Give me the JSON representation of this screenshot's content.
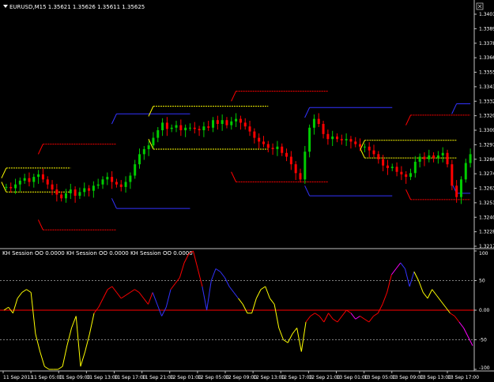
{
  "window": {
    "title": "EURUSD,M15  1.35621 1.35626 1.35611 1.35625",
    "menu_icon": "triangle-down-icon",
    "close_icon": "close-box-icon"
  },
  "indicator": {
    "label": "KH Session OO 0.0000  KH Session OO 0.0000  KH Session OO 0.0000"
  },
  "colors": {
    "background": "#000000",
    "bull_candle": "#00cc00",
    "bear_candle": "#ff0000",
    "band_yellow": "#ffff00",
    "band_red": "#ff0000",
    "band_blue": "#3333ff",
    "osc_yellow": "#ffff00",
    "osc_red": "#ff0000",
    "osc_blue": "#3333ff",
    "osc_magenta": "#ff00ff",
    "zero_line": "#ff0000",
    "level_line": "#808080",
    "axis": "#c0c0c0"
  },
  "chart_data": [
    {
      "type": "candlestick",
      "symbol": "EURUSD",
      "timeframe": "M15",
      "y_ticks": [
        "1.34010",
        "1.33895",
        "1.33780",
        "1.33665",
        "1.33550",
        "1.33435",
        "1.33320",
        "1.33205",
        "1.33090",
        "1.32975",
        "1.32860",
        "1.32745",
        "1.32630",
        "1.32515",
        "1.32400",
        "1.32285",
        "1.32170"
      ],
      "ylim": [
        1.3217,
        1.3401
      ],
      "closes": [
        1.3264,
        1.3263,
        1.3266,
        1.3269,
        1.3271,
        1.3268,
        1.3272,
        1.3274,
        1.327,
        1.3266,
        1.3262,
        1.3258,
        1.3255,
        1.3259,
        1.3262,
        1.3257,
        1.326,
        1.3263,
        1.3261,
        1.3265,
        1.3266,
        1.327,
        1.3272,
        1.3268,
        1.3266,
        1.3264,
        1.3268,
        1.3273,
        1.3282,
        1.329,
        1.3294,
        1.3297,
        1.3303,
        1.3309,
        1.3315,
        1.331,
        1.3311,
        1.3313,
        1.3309,
        1.3311,
        1.3311,
        1.331,
        1.3309,
        1.3312,
        1.3311,
        1.3317,
        1.3314,
        1.3317,
        1.3313,
        1.3316,
        1.3318,
        1.3315,
        1.3312,
        1.3308,
        1.3303,
        1.33,
        1.3298,
        1.3295,
        1.3294,
        1.3296,
        1.3291,
        1.3288,
        1.3282,
        1.3275,
        1.327,
        1.3292,
        1.3311,
        1.3318,
        1.3314,
        1.3306,
        1.3302,
        1.3304,
        1.3302,
        1.3301,
        1.3302,
        1.33,
        1.3298,
        1.3296,
        1.3296,
        1.3293,
        1.329,
        1.3286,
        1.3281,
        1.3279,
        1.328,
        1.3276,
        1.3274,
        1.3272,
        1.3275,
        1.3284,
        1.3288,
        1.3286,
        1.3289,
        1.3287,
        1.3289,
        1.3291,
        1.3282,
        1.3265,
        1.3256,
        1.327,
        1.3283,
        1.329
      ],
      "x_ticks": [
        "11 Sep 2013",
        "11 Sep 05:00",
        "11 Sep 09:00",
        "11 Sep 13:00",
        "11 Sep 17:00",
        "11 Sep 21:00",
        "12 Sep 01:00",
        "12 Sep 05:00",
        "12 Sep 09:00",
        "12 Sep 13:00",
        "12 Sep 17:00",
        "12 Sep 21:00",
        "13 Sep 01:00",
        "13 Sep 05:00",
        "13 Sep 09:00",
        "13 Sep 13:00",
        "13 Sep 17:00"
      ],
      "session_bands": [
        {
          "color": "#ffff00",
          "start": 0,
          "end": 14,
          "upper": 1.3279,
          "lower": 1.326
        },
        {
          "color": "#ff0000",
          "start": 8,
          "end": 24,
          "upper": 1.3298,
          "lower": 1.323
        },
        {
          "color": "#3333ff",
          "start": 24,
          "end": 40,
          "upper": 1.3322,
          "lower": 1.3247
        },
        {
          "color": "#ffff00",
          "start": 32,
          "end": 57,
          "upper": 1.3328,
          "lower": 1.3294
        },
        {
          "color": "#ff0000",
          "start": 50,
          "end": 70,
          "upper": 1.334,
          "lower": 1.3268
        },
        {
          "color": "#3333ff",
          "start": 66,
          "end": 84,
          "upper": 1.3327,
          "lower": 1.3257
        },
        {
          "color": "#ffff00",
          "start": 78,
          "end": 98,
          "upper": 1.3301,
          "lower": 1.3287
        },
        {
          "color": "#ff0000",
          "start": 88,
          "end": 104,
          "upper": 1.3321,
          "lower": 1.3254
        },
        {
          "color": "#3333ff",
          "start": 98,
          "end": 104,
          "upper": 1.333,
          "lower": 1.3259
        }
      ]
    },
    {
      "type": "line",
      "name": "KH Session OO",
      "y_ticks": [
        "100",
        "50",
        "0.00",
        "-50",
        "-100"
      ],
      "ylim": [
        -100,
        100
      ],
      "levels": [
        50,
        0,
        -50
      ],
      "values": [
        0,
        5,
        -5,
        20,
        30,
        35,
        30,
        -40,
        -70,
        -95,
        -100,
        -100,
        -100,
        -95,
        -60,
        -30,
        -10,
        -95,
        -70,
        -40,
        -5,
        5,
        20,
        35,
        40,
        30,
        20,
        25,
        30,
        35,
        30,
        20,
        10,
        30,
        10,
        -10,
        5,
        35,
        45,
        55,
        80,
        95,
        100,
        70,
        40,
        0,
        50,
        70,
        65,
        55,
        40,
        30,
        20,
        10,
        -5,
        -5,
        20,
        35,
        40,
        20,
        10,
        -30,
        -50,
        -55,
        -40,
        -30,
        -70,
        -20,
        -10,
        -5,
        -10,
        -20,
        -5,
        -15,
        -20,
        -10,
        0,
        -5,
        -15,
        -10,
        -15,
        -20,
        -10,
        -5,
        10,
        30,
        60,
        70,
        80,
        70,
        40,
        65,
        50,
        30,
        20,
        35,
        25,
        15,
        5,
        -5,
        -10,
        -20,
        -30,
        -45,
        -60
      ],
      "segment_colors": [
        "#ffff00",
        "#ffff00",
        "#ffff00",
        "#ffff00",
        "#ffff00",
        "#ffff00",
        "#ffff00",
        "#ffff00",
        "#ffff00",
        "#ffff00",
        "#ffff00",
        "#ffff00",
        "#ffff00",
        "#ffff00",
        "#ffff00",
        "#ffff00",
        "#ffff00",
        "#ffff00",
        "#ffff00",
        "#ffff00",
        "#ff0000",
        "#ff0000",
        "#ff0000",
        "#ff0000",
        "#ff0000",
        "#ff0000",
        "#ff0000",
        "#ff0000",
        "#ff0000",
        "#ff0000",
        "#ff0000",
        "#ff0000",
        "#ff0000",
        "#3333ff",
        "#3333ff",
        "#3333ff",
        "#3333ff",
        "#ff0000",
        "#ff0000",
        "#ff0000",
        "#ff0000",
        "#ff0000",
        "#ff0000",
        "#ff0000",
        "#3333ff",
        "#3333ff",
        "#3333ff",
        "#3333ff",
        "#3333ff",
        "#3333ff",
        "#3333ff",
        "#3333ff",
        "#ffff00",
        "#ffff00",
        "#ffff00",
        "#ffff00",
        "#ffff00",
        "#ffff00",
        "#ffff00",
        "#ffff00",
        "#ffff00",
        "#ffff00",
        "#ffff00",
        "#ffff00",
        "#ffff00",
        "#ffff00",
        "#ffff00",
        "#ff0000",
        "#ff0000",
        "#ff0000",
        "#ff0000",
        "#ff0000",
        "#ff0000",
        "#ff0000",
        "#ff0000",
        "#ff0000",
        "#ff0000",
        "#ff00ff",
        "#ff00ff",
        "#ff0000",
        "#ff0000",
        "#ff0000",
        "#ff0000",
        "#ff0000",
        "#ff0000",
        "#ff0000",
        "#ff00ff",
        "#ff00ff",
        "#3333ff",
        "#3333ff",
        "#3333ff",
        "#ffff00",
        "#ffff00",
        "#ffff00",
        "#ffff00",
        "#ffff00",
        "#ffff00",
        "#ffff00",
        "#ffff00",
        "#ff0000",
        "#ff0000",
        "#ff00ff",
        "#ff00ff",
        "#ff00ff",
        "#3333ff"
      ]
    }
  ]
}
